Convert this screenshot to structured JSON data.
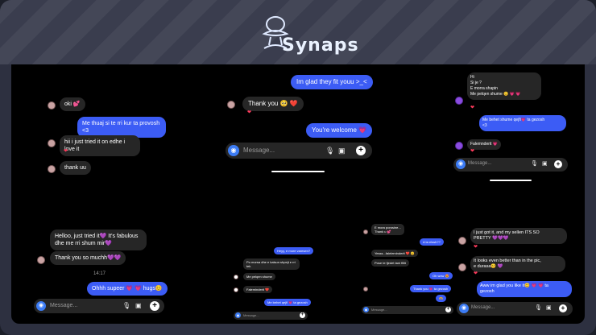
{
  "brand": {
    "name": "Synaps"
  },
  "composer": {
    "placeholder": "Message..."
  },
  "icons": {
    "camera": "camera-icon",
    "mic": "microphone-icon",
    "image": "image-icon",
    "plus": "plus-icon",
    "heart": "heart-reaction-icon"
  },
  "colors": {
    "outgoing": "#3c5cf5",
    "incoming": "#262626",
    "background": "#000000"
  },
  "chat1": {
    "m1": "oki 💕",
    "m2": "Me thuaj si te rri kur ta provosh <3",
    "m3": "hii i just tried it on edhe i love it",
    "m4": "thank uu"
  },
  "chat2": {
    "m1": "Im glad they fit youu >_<",
    "m2": "Thank you 🥺 ❤️",
    "m3": "You're welcome 💗"
  },
  "chat3": {
    "m1": "Hi\nSi je ?\nE morra shapin\nMe pelqen shume 😊 💗 💗",
    "m2": "Me behet shume qejfi💗 ta gezosh\n<3",
    "m3": "Falemnderit 💗"
  },
  "chat4": {
    "m1": "Helloo, just tried it💜 It's fabulous\ndhe me rri shum mir💜",
    "m2": "Thank you so muchh💜💜",
    "time": "14:17",
    "m3": "Ohhh supeer 💗 💗 hugs😊"
  },
  "chat5": {
    "m1": "Heyy, e more varesen?",
    "m2": "Po morsa dhe e kalsun shpejt e rri tek",
    "m3": "Me pelqen shume",
    "m4": "Faleminderit ❤️",
    "m5": "Me behet qejfi 💗 ta gezosh"
  },
  "chat6": {
    "m1": "E mora porosine...\nThank u 💕",
    "m2": "A ta elssh??",
    "m3": "Yesss...faleleminderit ❤️ 😊",
    "m4": "Pose te fjedet tani fillit",
    "m5": "Oh wow 😍",
    "m6": "Thank you 💗 ta gezosh",
    "m7": "🫶"
  },
  "chat7": {
    "m1": "I just got it, and my sellen ITS SO\nPRETTY 💜💜💜",
    "m2": "It looks even better than in the pic,\ne durasa😊 💜",
    "m3": "Aww im glad you like it😊 💗 💗 ta\ngezosh"
  }
}
